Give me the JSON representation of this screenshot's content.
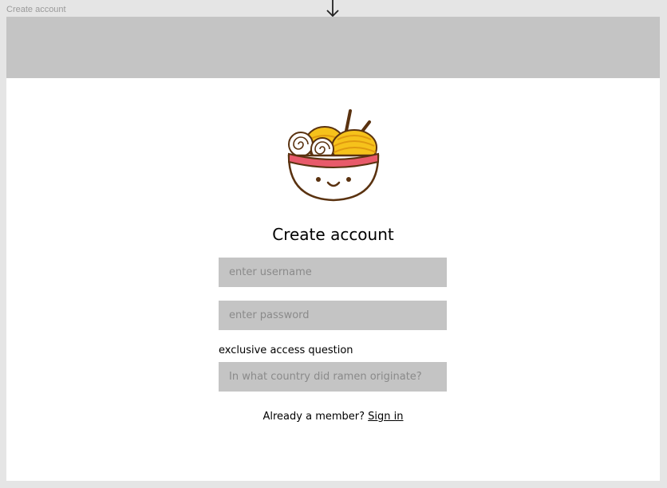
{
  "frame": {
    "label": "Create account"
  },
  "header": {
    "title": "Create account"
  },
  "form": {
    "username_placeholder": "enter username",
    "username_value": "",
    "password_placeholder": "enter password",
    "password_value": "",
    "question_label": "exclusive access question",
    "question_placeholder": "In what country did ramen originate?",
    "question_value": ""
  },
  "footer": {
    "member_text": "Already a member?",
    "sign_in_label": "Sign in"
  },
  "icons": {
    "logo": "ramen-bowl-icon",
    "arrow": "arrow-down-icon"
  },
  "colors": {
    "banner": "#c4c4c4",
    "field_bg": "#c4c4c4",
    "bowl_outline": "#5a3210",
    "bowl_band": "#e85a6a",
    "noodle": "#f6c21b"
  }
}
